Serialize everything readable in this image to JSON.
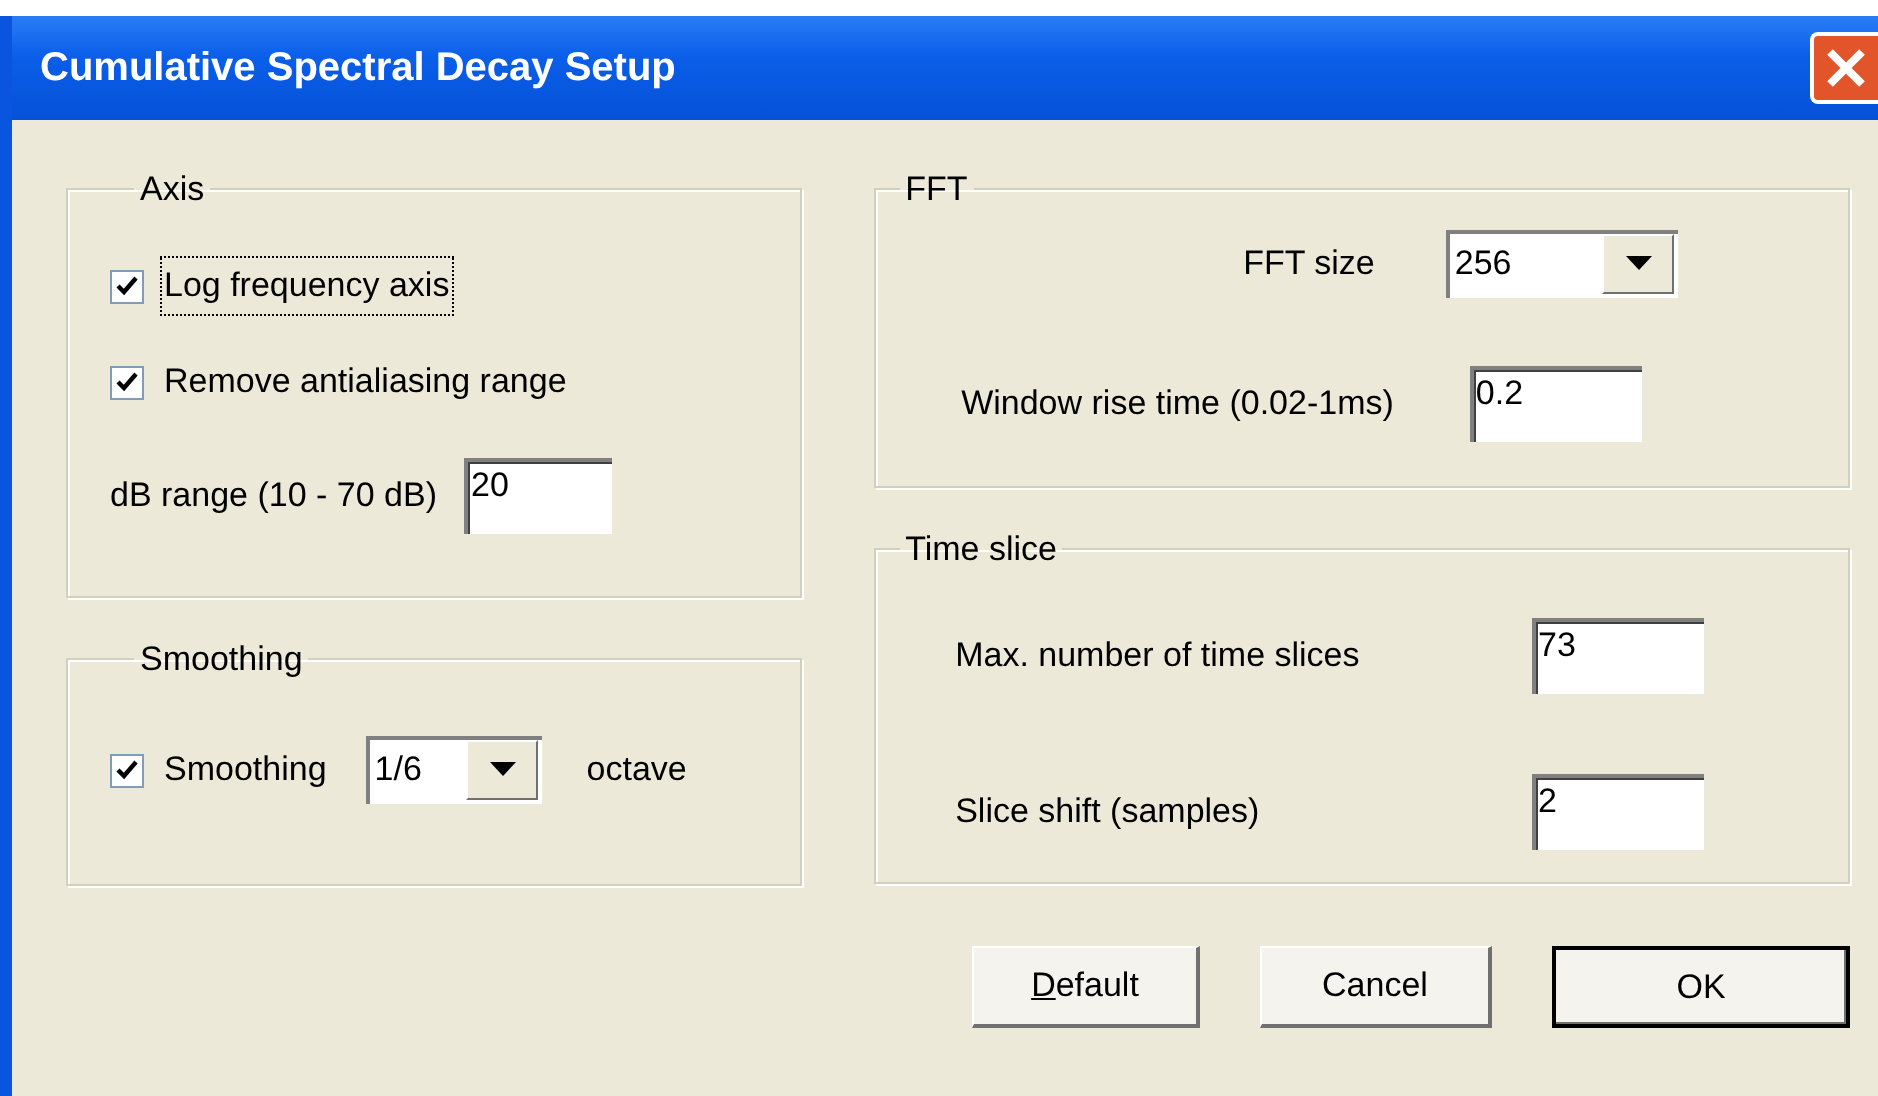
{
  "window": {
    "title": "Cumulative Spectral Decay Setup"
  },
  "axis": {
    "title": "Axis",
    "checkboxes": [
      {
        "label": "Log frequency axis",
        "checked": true,
        "focused": true
      },
      {
        "label": "Remove antialiasing range",
        "checked": true,
        "focused": false
      }
    ],
    "db_range": {
      "label": "dB range (10 - 70 dB)",
      "value": "20"
    }
  },
  "smoothing": {
    "title": "Smoothing",
    "checkbox": {
      "label": "Smoothing",
      "checked": true
    },
    "dropdown": {
      "value": "1/6"
    },
    "unit": "octave"
  },
  "fft": {
    "title": "FFT",
    "size": {
      "label": "FFT size",
      "value": "256"
    },
    "rise_time": {
      "label": "Window rise time (0.02-1ms)",
      "value": "0.2"
    }
  },
  "time_slice": {
    "title": "Time slice",
    "fields": [
      {
        "label": "Max. number of time slices",
        "value": "73"
      },
      {
        "label": "Slice shift (samples)",
        "value": "2"
      }
    ]
  },
  "buttons": [
    {
      "label": "Default",
      "first_letter_underlined": true,
      "default": false
    },
    {
      "label": "Cancel",
      "default": false
    },
    {
      "label": "OK",
      "default": true
    }
  ]
}
